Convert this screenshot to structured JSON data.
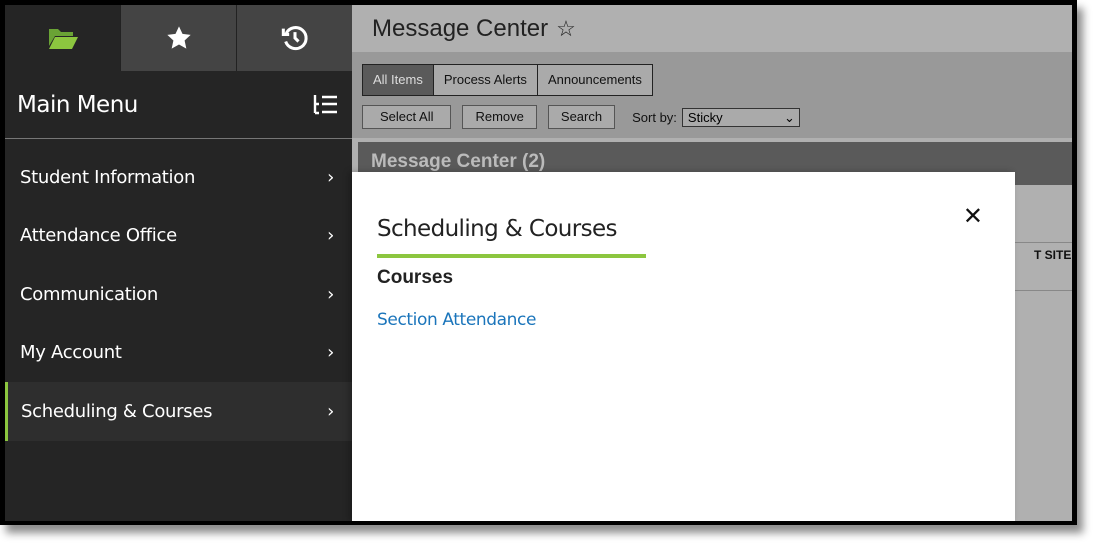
{
  "sidebar": {
    "tabs": [
      {
        "icon": "folder-open-icon",
        "active": true
      },
      {
        "icon": "star-icon"
      },
      {
        "icon": "history-icon"
      }
    ],
    "title": "Main Menu",
    "items": [
      {
        "label": "Student Information"
      },
      {
        "label": "Attendance Office"
      },
      {
        "label": "Communication"
      },
      {
        "label": "My Account"
      },
      {
        "label": "Scheduling & Courses",
        "selected": true
      }
    ],
    "chevron": "›"
  },
  "header": {
    "title": "Message Center",
    "star": "☆"
  },
  "toolbar": {
    "tabs": [
      "All Items",
      "Process Alerts",
      "Announcements"
    ],
    "select_all": "Select All",
    "remove": "Remove",
    "search": "Search",
    "sort_label": "Sort by:",
    "sort_value": "Sticky"
  },
  "panel": {
    "title": "Message Center (2)",
    "partial_text": "T SITE - I"
  },
  "modal": {
    "title": "Scheduling & Courses",
    "section": "Courses",
    "link": "Section Attendance",
    "close": "✕"
  },
  "colors": {
    "accent": "#8cc63f",
    "link": "#1b75bb",
    "sidebar": "#252525"
  }
}
